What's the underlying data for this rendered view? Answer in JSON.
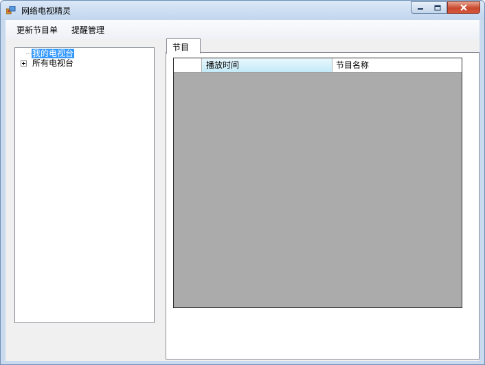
{
  "window": {
    "title": "网络电视精灵",
    "controls": [
      "minimize",
      "maximize",
      "close"
    ]
  },
  "menu": {
    "items": [
      {
        "label": "更新节目单"
      },
      {
        "label": "提醒管理"
      }
    ]
  },
  "tree": {
    "nodes": [
      {
        "label": "我的电视台",
        "selected": true,
        "expandable": false
      },
      {
        "label": "所有电视台",
        "selected": false,
        "expandable": true,
        "expanded": false
      }
    ]
  },
  "tabs": [
    {
      "label": "节目",
      "active": true
    }
  ],
  "grid": {
    "columns": [
      "播放时间",
      "节目名称"
    ],
    "rows": []
  },
  "colors": {
    "selection": "#3399ff",
    "grid_background": "#ababab",
    "sorted_column_header": "#c3ebf8",
    "close_button": "#c84a2e"
  },
  "icons": {
    "app": "app-window-icon",
    "minimize": "minimize-icon",
    "maximize": "maximize-icon",
    "close": "close-icon",
    "expander": "plus-expander-icon"
  }
}
